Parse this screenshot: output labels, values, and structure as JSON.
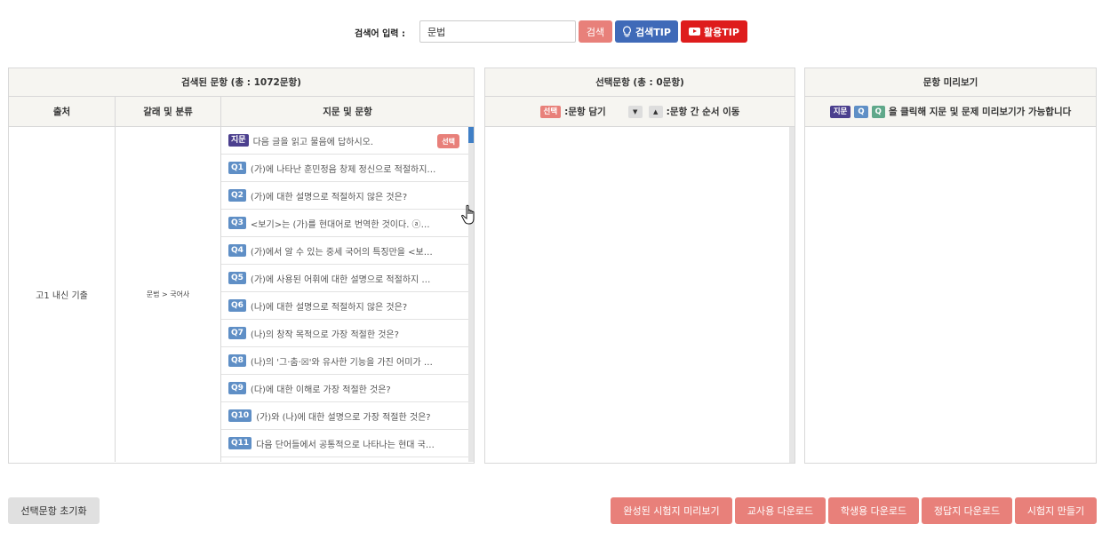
{
  "search": {
    "label": "검색어 입력 :",
    "value": "문법",
    "search_btn": "검색",
    "tip_btn": "검색TIP",
    "use_tip_btn": "활용TIP"
  },
  "results_panel": {
    "title": "검색된 문항 (총 : 1072문항)",
    "columns": [
      "출처",
      "갈래 및 분류",
      "지문 및 문항"
    ],
    "source": "고1 내신 기출",
    "category": "문법 > 국어사",
    "select_btn": "선택",
    "items": [
      {
        "tag": "지문",
        "text": "다음 글을 읽고 물음에 답하시오."
      },
      {
        "tag": "Q1",
        "text": "(가)에 나타난 훈민정음 창제 정신으로 적절하지 …"
      },
      {
        "tag": "Q2",
        "text": "(가)에 대한 설명으로 적절하지 않은 것은?"
      },
      {
        "tag": "Q3",
        "text": "<보기>는 (가)를 현대어로 번역한 것이다. ⓐ~ⓔ…"
      },
      {
        "tag": "Q4",
        "text": "(가)에서 알 수 있는 중세 국어의 특징만을 <보기…"
      },
      {
        "tag": "Q5",
        "text": "(가)에 사용된 어휘에 대한 설명으로 적절하지 않…"
      },
      {
        "tag": "Q6",
        "text": "(나)에 대한 설명으로 적절하지 않은 것은?"
      },
      {
        "tag": "Q7",
        "text": "(나)의 창작 목적으로 가장 적절한 것은?"
      },
      {
        "tag": "Q8",
        "text": "(나)의 '그·춤·☒'와 유사한 기능을 가진 어미가 …"
      },
      {
        "tag": "Q9",
        "text": " (다)에 대한 이해로 가장 적절한 것은?"
      },
      {
        "tag": "Q10",
        "text": "(가)와 (나)에 대한 설명으로 가장 적절한 것은?"
      },
      {
        "tag": "Q11",
        "text": "다음 단어들에서 공통적으로 나타나는 현대 국…"
      }
    ]
  },
  "selected_panel": {
    "title": "선택문항 (총 : 0문항)",
    "select_tag": "선택",
    "add_label": ":문항 담기",
    "move_label": ":문항 간 순서 이동",
    "down_arrow": "▼",
    "up_arrow": "▲"
  },
  "preview_panel": {
    "title": "문항 미리보기",
    "tag_jimun": "지문",
    "tag_q1": "Q",
    "tag_q2": "Q",
    "hint": "을 클릭해 지문 및 문제 미리보기가 가능합니다"
  },
  "bottom": {
    "reset": "선택문항 초기화",
    "preview_exam": "완성된 시험지 미리보기",
    "teacher_dl": "교사용 다운로드",
    "student_dl": "학생용 다운로드",
    "answer_dl": "정답지 다운로드",
    "make_exam": "시험지 만들기"
  },
  "colors": {
    "accent_red": "#e8807a",
    "tip_blue": "#3f6ab8",
    "youtube_red": "#de1c1c",
    "jimun_purple": "#4b3f8e",
    "q_blue": "#5f8fc6",
    "q_green": "#5fa88a"
  }
}
